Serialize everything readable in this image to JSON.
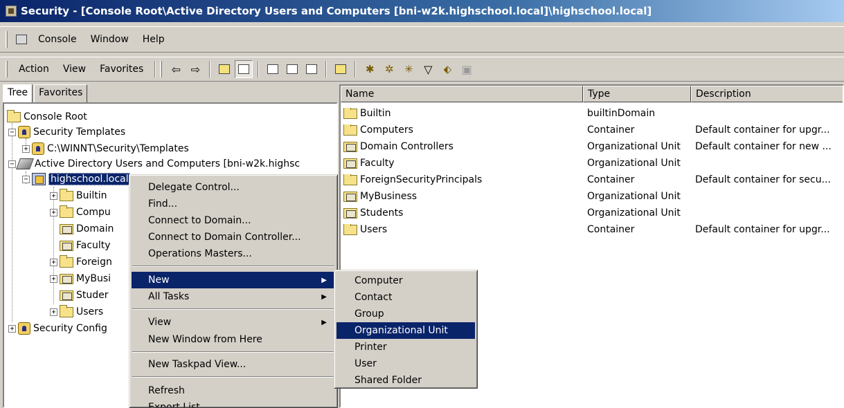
{
  "window": {
    "title": "Security - [Console Root\\Active Directory Users and Computers [bni-w2k.highschool.local]\\highschool.local]"
  },
  "menubar": {
    "console": "Console",
    "window": "Window",
    "help": "Help"
  },
  "actionbar": {
    "action": "Action",
    "view": "View",
    "favorites": "Favorites"
  },
  "tabs": {
    "tree": "Tree",
    "favorites": "Favorites"
  },
  "tree": {
    "console_root": "Console Root",
    "security_templates": "Security Templates",
    "templates_path": "C:\\WINNT\\Security\\Templates",
    "aduc": "Active Directory Users and Computers [bni-w2k.highsc",
    "domain": "highschool.local",
    "builtin": "Builtin",
    "computers": "Compu",
    "domain_controllers": "Domain",
    "faculty": "Faculty",
    "foreign": "Foreign",
    "mybusiness": "MyBusi",
    "students": "Studer",
    "users": "Users",
    "security_config": "Security Config"
  },
  "list": {
    "columns": {
      "name": "Name",
      "type": "Type",
      "description": "Description"
    },
    "rows": [
      {
        "name": "Builtin",
        "type": "builtinDomain",
        "description": ""
      },
      {
        "name": "Computers",
        "type": "Container",
        "description": "Default container for upgr..."
      },
      {
        "name": "Domain Controllers",
        "type": "Organizational Unit",
        "description": "Default container for new ..."
      },
      {
        "name": "Faculty",
        "type": "Organizational Unit",
        "description": ""
      },
      {
        "name": "ForeignSecurityPrincipals",
        "type": "Container",
        "description": "Default container for secu..."
      },
      {
        "name": "MyBusiness",
        "type": "Organizational Unit",
        "description": ""
      },
      {
        "name": "Students",
        "type": "Organizational Unit",
        "description": ""
      },
      {
        "name": "Users",
        "type": "Container",
        "description": "Default container for upgr..."
      }
    ]
  },
  "context_menu": {
    "delegate": "Delegate Control...",
    "find": "Find...",
    "connect_domain": "Connect to Domain...",
    "connect_dc": "Connect to Domain Controller...",
    "operations": "Operations Masters...",
    "new": "New",
    "all_tasks": "All Tasks",
    "view": "View",
    "new_window": "New Window from Here",
    "new_taskpad": "New Taskpad View...",
    "refresh": "Refresh",
    "export": "Export List..."
  },
  "submenu": {
    "computer": "Computer",
    "contact": "Contact",
    "group": "Group",
    "ou": "Organizational Unit",
    "printer": "Printer",
    "user": "User",
    "shared_folder": "Shared Folder"
  },
  "colors": {
    "titlebar": "#0a246a",
    "highlight": "#0a246a",
    "face": "#d4d0c8"
  }
}
